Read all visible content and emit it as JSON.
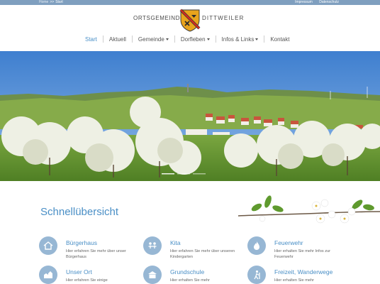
{
  "topbar": {
    "breadcrumb_home": "Home",
    "breadcrumb_sep": ">>",
    "breadcrumb_current": "Start",
    "links": [
      "Impressum",
      "Datenschutz"
    ]
  },
  "header": {
    "title_left": "ORTSGEMEINDE",
    "title_right": "DITTWEILER"
  },
  "nav": {
    "items": [
      {
        "label": "Start",
        "active": true,
        "dropdown": false
      },
      {
        "label": "Aktuell",
        "active": false,
        "dropdown": false
      },
      {
        "label": "Gemeinde",
        "active": false,
        "dropdown": true
      },
      {
        "label": "Dorfleben",
        "active": false,
        "dropdown": true
      },
      {
        "label": "Infos & Links",
        "active": false,
        "dropdown": true
      },
      {
        "label": "Kontakt",
        "active": false,
        "dropdown": false
      }
    ]
  },
  "quick": {
    "title": "Schnellübersicht",
    "cards": [
      {
        "icon": "house-icon",
        "title": "Bürgerhaus",
        "desc": "Hier erfahren Sie mehr über unser Bürgerhaus"
      },
      {
        "icon": "children-icon",
        "title": "Kita",
        "desc": "Hier erfahren Sie mehr über unseren Kindergarten"
      },
      {
        "icon": "fire-icon",
        "title": "Feuerwehr",
        "desc": "Hier erhalten Sie mehr Infos zur Feuerwehr"
      },
      {
        "icon": "village-icon",
        "title": "Unser Ort",
        "desc": "Hier erfahren Sie einige"
      },
      {
        "icon": "school-icon",
        "title": "Grundschule",
        "desc": "Hier erhalten Sie mehr"
      },
      {
        "icon": "hiker-icon",
        "title": "Freizeit, Wanderwege",
        "desc": "Hier erhalten Sie mehr"
      }
    ]
  },
  "colors": {
    "accent": "#4a8fc6",
    "topbar": "#7f9fbf",
    "icon_circle": "#97b7d4"
  }
}
